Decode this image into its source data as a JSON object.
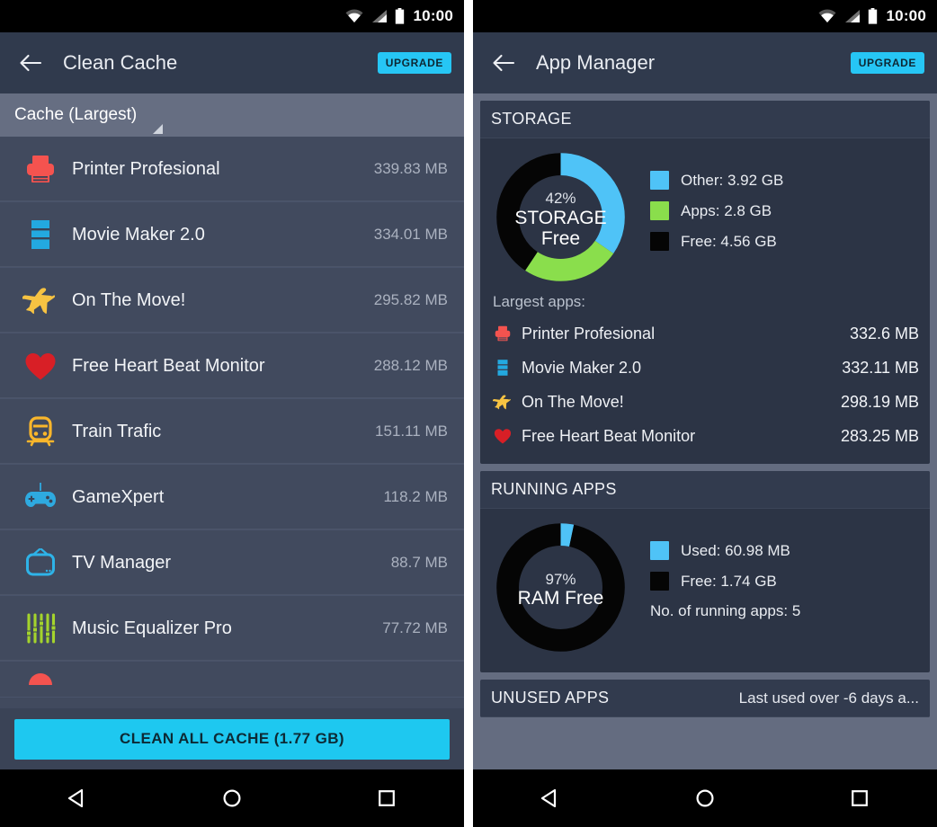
{
  "statusbar": {
    "time": "10:00",
    "icons": [
      "wifi-icon",
      "signal-icon",
      "battery-icon"
    ]
  },
  "colors": {
    "accent_cyan": "#26c6f5",
    "blue": "#4fc3f7",
    "green": "#8ade4c",
    "black": "#050505",
    "red": "#f0403c",
    "orange": "#f5b731",
    "screen_bg": "#3a4356",
    "card_bg": "#2c3445",
    "row_bg": "#414a5e"
  },
  "left_screen": {
    "appbar": {
      "back_label": "back",
      "title": "Clean Cache",
      "upgrade_label": "UPGRADE"
    },
    "sort_tab": "Cache (Largest)",
    "cache_items": [
      {
        "name": "Printer Profesional",
        "size": "339.83 MB",
        "icon": "printer-icon",
        "color": "#f4534f"
      },
      {
        "name": "Movie Maker 2.0",
        "size": "334.01 MB",
        "icon": "film-icon",
        "color": "#23a9e0"
      },
      {
        "name": "On The Move!",
        "size": "295.82 MB",
        "icon": "airplane-icon",
        "color": "#f7c342"
      },
      {
        "name": "Free Heart Beat Monitor",
        "size": "288.12 MB",
        "icon": "heart-icon",
        "color": "#d81f26"
      },
      {
        "name": "Train Trafic",
        "size": "151.11 MB",
        "icon": "train-icon",
        "color": "#f9b62b"
      },
      {
        "name": "GameXpert",
        "size": "118.2 MB",
        "icon": "gamepad-icon",
        "color": "#2eaae0"
      },
      {
        "name": "TV Manager",
        "size": "88.7 MB",
        "icon": "television-icon",
        "color": "#2eb3e8"
      },
      {
        "name": "Music Equalizer Pro",
        "size": "77.72 MB",
        "icon": "equalizer-icon",
        "color": "#a4d42c"
      }
    ],
    "clean_button": "CLEAN ALL CACHE (1.77 GB)"
  },
  "right_screen": {
    "appbar": {
      "back_label": "back",
      "title": "App Manager",
      "upgrade_label": "UPGRADE"
    },
    "storage_card": {
      "title": "STORAGE",
      "donut_percent": "42%",
      "donut_label_line1": "STORAGE",
      "donut_label_line2": "Free",
      "legend": [
        {
          "label": "Other: 3.92 GB",
          "color": "#4fc3f7"
        },
        {
          "label": "Apps: 2.8 GB",
          "color": "#8ade4c"
        },
        {
          "label": "Free: 4.56 GB",
          "color": "#050505"
        }
      ],
      "largest_title": "Largest apps:",
      "largest_apps": [
        {
          "name": "Printer Profesional",
          "size": "332.6 MB",
          "icon": "printer-icon",
          "color": "#f4534f"
        },
        {
          "name": "Movie Maker 2.0",
          "size": "332.11 MB",
          "icon": "film-icon",
          "color": "#23a9e0"
        },
        {
          "name": "On The Move!",
          "size": "298.19 MB",
          "icon": "airplane-icon",
          "color": "#f7c342"
        },
        {
          "name": "Free Heart Beat Monitor",
          "size": "283.25 MB",
          "icon": "heart-icon",
          "color": "#d81f26"
        }
      ]
    },
    "running_card": {
      "title": "RUNNING APPS",
      "donut_percent": "97%",
      "donut_label": "RAM Free",
      "legend": [
        {
          "label": "Used: 60.98 MB",
          "color": "#4fc3f7"
        },
        {
          "label": "Free: 1.74 GB",
          "color": "#050505"
        }
      ],
      "running_count_note": "No. of running apps: 5"
    },
    "unused_card": {
      "title": "UNUSED APPS",
      "subtitle": "Last used over -6 days a..."
    }
  },
  "navbar": {
    "back": "back-triangle-icon",
    "home": "home-circle-icon",
    "recents": "recents-square-icon"
  },
  "chart_data": [
    {
      "type": "pie",
      "title": "STORAGE",
      "center_label": "42% STORAGE Free",
      "categories": [
        "Other",
        "Apps",
        "Free"
      ],
      "values": [
        3.92,
        2.8,
        4.56
      ],
      "unit": "GB",
      "percents": [
        34.6,
        24.7,
        40.7
      ],
      "colors": [
        "#4fc3f7",
        "#8ade4c",
        "#050505"
      ],
      "legend": "right",
      "donut": true
    },
    {
      "type": "pie",
      "title": "RUNNING APPS",
      "center_label": "97% RAM Free",
      "categories": [
        "Used",
        "Free"
      ],
      "values": [
        0.0595,
        1.74
      ],
      "unit": "GB",
      "percents": [
        3.3,
        96.7
      ],
      "colors": [
        "#4fc3f7",
        "#050505"
      ],
      "legend": "right",
      "donut": true
    }
  ]
}
